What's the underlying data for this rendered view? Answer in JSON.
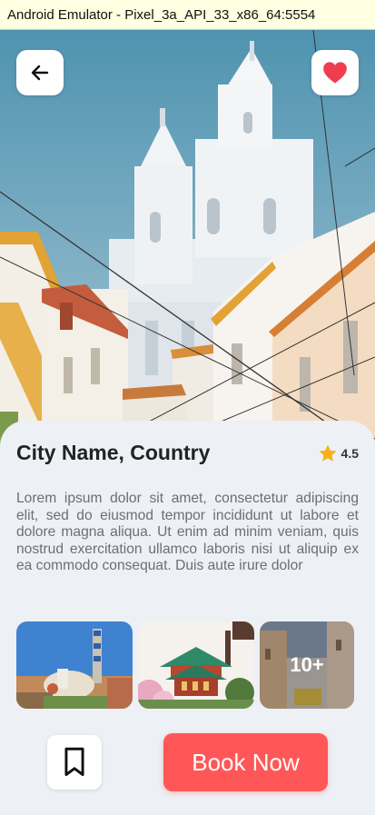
{
  "window": {
    "title": "Android Emulator - Pixel_3a_API_33_x86_64:5554"
  },
  "header": {
    "back_icon": "arrow-left-icon",
    "favorite_icon": "heart-icon",
    "favorite_color": "#ef3d4f"
  },
  "place": {
    "name": "City Name, Country",
    "rating": "4.5",
    "rating_icon": "star-icon",
    "star_color": "#f6b21b",
    "description": "Lorem ipsum dolor sit amet, consectetur adipiscing elit, sed do eiusmod tempor incididunt ut labore et dolore magna aliqua. Ut enim ad minim veniam, quis nostrud exercitation ullamco laboris nisi ut aliquip ex ea commodo consequat. Duis aute irure dolor"
  },
  "gallery": {
    "more_label": "10+"
  },
  "actions": {
    "bookmark_icon": "bookmark-icon",
    "book_label": "Book Now",
    "book_color": "#ff5757"
  }
}
